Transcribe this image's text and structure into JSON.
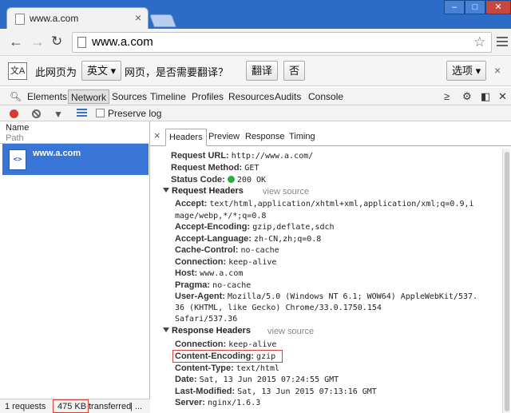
{
  "browser": {
    "tab_title": "www.a.com",
    "tab_close": "×",
    "url": "www.a.com",
    "window_controls": {
      "minimize": "–",
      "maximize": "□",
      "close": "✕"
    }
  },
  "translate_bar": {
    "icon_text": "文A",
    "prefix": "此网页为",
    "language": "英文 ▾",
    "suffix": "网页，是否需要翻译？",
    "translate_button": "翻译",
    "no_button": "否",
    "options_button": "选项 ▾",
    "close": "×"
  },
  "devtools": {
    "tabs": [
      "Elements",
      "Network",
      "Sources",
      "Timeline",
      "Profiles",
      "Resources",
      "Audits",
      "Console"
    ],
    "active_tab": "Network",
    "preserve_log": "Preserve log"
  },
  "request_list": {
    "col_name": "Name",
    "col_path": "Path",
    "requests": [
      {
        "name": "www.a.com",
        "icon": "<>"
      }
    ],
    "status": {
      "requests": "1 requests",
      "size": "475 KB",
      "transferred": "transferred",
      "more": "|  ..."
    }
  },
  "details": {
    "close": "×",
    "tabs": [
      "Headers",
      "Preview",
      "Response",
      "Timing"
    ],
    "active_tab": "Headers",
    "general": [
      {
        "key": "Request URL:",
        "value": "http://www.a.com/"
      },
      {
        "key": "Request Method:",
        "value": "GET"
      },
      {
        "key": "Status Code:",
        "value": "200 OK"
      }
    ],
    "request_headers_title": "Request Headers",
    "request_headers_view_source": "view source",
    "request_headers": [
      {
        "key": "Accept:",
        "value": "text/html,application/xhtml+xml,application/xml;q=0.9,i",
        "cont": "mage/webp,*/*;q=0.8"
      },
      {
        "key": "Accept-Encoding:",
        "value": "gzip,deflate,sdch"
      },
      {
        "key": "Accept-Language:",
        "value": "zh-CN,zh;q=0.8"
      },
      {
        "key": "Cache-Control:",
        "value": "no-cache"
      },
      {
        "key": "Connection:",
        "value": "keep-alive"
      },
      {
        "key": "Host:",
        "value": "www.a.com"
      },
      {
        "key": "Pragma:",
        "value": "no-cache"
      },
      {
        "key": "User-Agent:",
        "value": "Mozilla/5.0 (Windows NT 6.1; WOW64) AppleWebKit/537.",
        "cont": "36 (KHTML, like Gecko) Chrome/33.0.1750.154",
        "cont2": "Safari/537.36"
      }
    ],
    "response_headers_title": "Response Headers",
    "response_headers_view_source": "view source",
    "response_headers": [
      {
        "key": "Connection:",
        "value": "keep-alive"
      },
      {
        "key": "Content-Encoding:",
        "value": "gzip"
      },
      {
        "key": "Content-Type:",
        "value": "text/html"
      },
      {
        "key": "Date:",
        "value": "Sat, 13 Jun 2015 07:24:55 GMT"
      },
      {
        "key": "Last-Modified:",
        "value": "Sat, 13 Jun 2015 07:13:16 GMT"
      },
      {
        "key": "Server:",
        "value": "nginx/1.6.3"
      }
    ]
  },
  "colors": {
    "accent": "#3875d7",
    "highlight": "#d4403a",
    "status_ok": "#2bab3a"
  }
}
